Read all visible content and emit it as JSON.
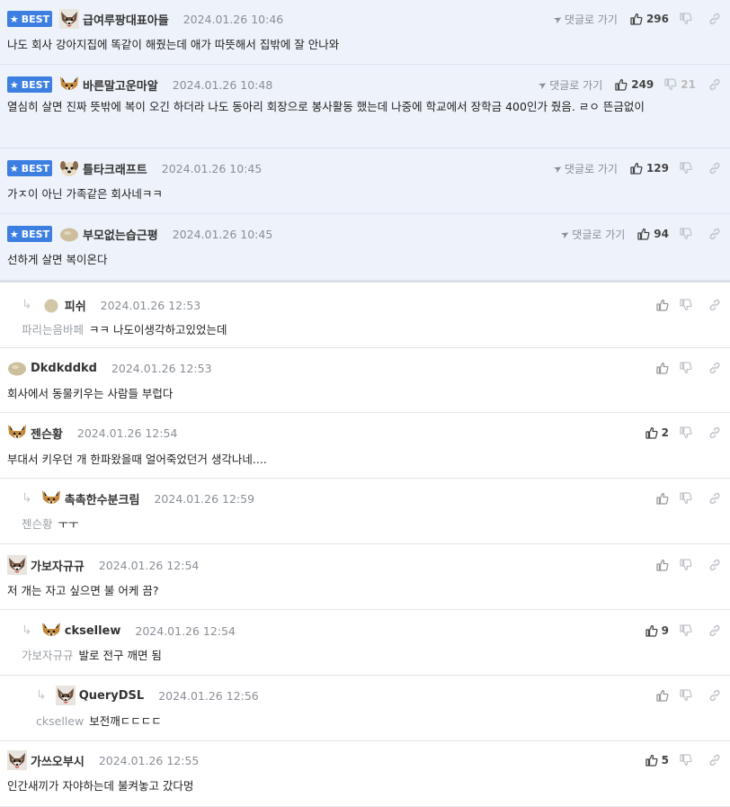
{
  "ui": {
    "best_label": "BEST",
    "goto_label": "댓글로 가기",
    "reply_arrow": "↳"
  },
  "comments": [
    {
      "best": true,
      "indent": 0,
      "avatar": "fox",
      "nick": "급여루팡대표아들",
      "date": "2024.01.26 10:46",
      "mention": "",
      "text": "나도 회사 강아지집에 똑같이 해줬는데 애가 따뜻해서 집밖에 잘 안나와",
      "goto": true,
      "likes": "296",
      "dislikes": ""
    },
    {
      "best": true,
      "indent": 0,
      "avatar": "shiba",
      "nick": "바른말고운마알",
      "date": "2024.01.26 10:48",
      "mention": "",
      "text": "열심히 살면 진짜 뜻밖에 복이 오긴 하더라 나도 동아리 회장으로 봉사활동 했는데 나중에 학교에서 장학금 400인가 줬음. ㄹㅇ 뜬금없이",
      "goto": true,
      "likes": "249",
      "dislikes": "21"
    },
    {
      "best": true,
      "indent": 0,
      "avatar": "puppy",
      "nick": "틀타크래프트",
      "date": "2024.01.26 10:45",
      "mention": "",
      "text": "가ㅈ이 아닌 가족같은 회사네ㅋㅋ",
      "goto": true,
      "likes": "129",
      "dislikes": ""
    },
    {
      "best": true,
      "indent": 0,
      "avatar": "blob",
      "nick": "부모없는습근평",
      "date": "2024.01.26 10:45",
      "mention": "",
      "text": "선하게 살면 복이온다",
      "goto": true,
      "likes": "94",
      "dislikes": ""
    },
    {
      "best": false,
      "indent": 1,
      "avatar": "dot",
      "nick": "피쉬",
      "date": "2024.01.26 12:53",
      "mention": "파리는음바페",
      "text": "ㅋㅋ 나도이생각하고있었는데",
      "goto": false,
      "likes": "",
      "dislikes": ""
    },
    {
      "best": false,
      "indent": 0,
      "avatar": "blob",
      "nick": "Dkdkddkd",
      "date": "2024.01.26 12:53",
      "mention": "",
      "text": "회사에서 동물키우는 사람들 부럽다",
      "goto": false,
      "likes": "",
      "dislikes": ""
    },
    {
      "best": false,
      "indent": 0,
      "avatar": "shiba",
      "nick": "젠슨황",
      "date": "2024.01.26 12:54",
      "mention": "",
      "text": "부대서 키우던 개 한파왔을때 얼어죽었던거 생각나네....",
      "goto": false,
      "likes": "2",
      "dislikes": ""
    },
    {
      "best": false,
      "indent": 1,
      "avatar": "shiba",
      "nick": "촉촉한수분크림",
      "date": "2024.01.26 12:59",
      "mention": "젠슨황",
      "text": "ㅜㅜ",
      "goto": false,
      "likes": "",
      "dislikes": ""
    },
    {
      "best": false,
      "indent": 0,
      "avatar": "fox",
      "nick": "가보자규규",
      "date": "2024.01.26 12:54",
      "mention": "",
      "text": "저 개는 자고 싶으면 불 어케 끔?",
      "goto": false,
      "likes": "",
      "dislikes": ""
    },
    {
      "best": false,
      "indent": 1,
      "avatar": "shiba",
      "nick": "cksellew",
      "date": "2024.01.26 12:54",
      "mention": "가보자규규",
      "text": "발로 전구 깨면 됨",
      "goto": false,
      "likes": "9",
      "dislikes": ""
    },
    {
      "best": false,
      "indent": 2,
      "avatar": "fox",
      "nick": "QueryDSL",
      "date": "2024.01.26 12:56",
      "mention": "cksellew",
      "text": "보전깨ㄷㄷㄷㄷ",
      "goto": false,
      "likes": "",
      "dislikes": ""
    },
    {
      "best": false,
      "indent": 0,
      "avatar": "fox",
      "nick": "가쓰오부시",
      "date": "2024.01.26 12:55",
      "mention": "",
      "text": "인간새끼가 자야하는데 불켜놓고 갔다멍",
      "goto": false,
      "likes": "5",
      "dislikes": ""
    }
  ]
}
